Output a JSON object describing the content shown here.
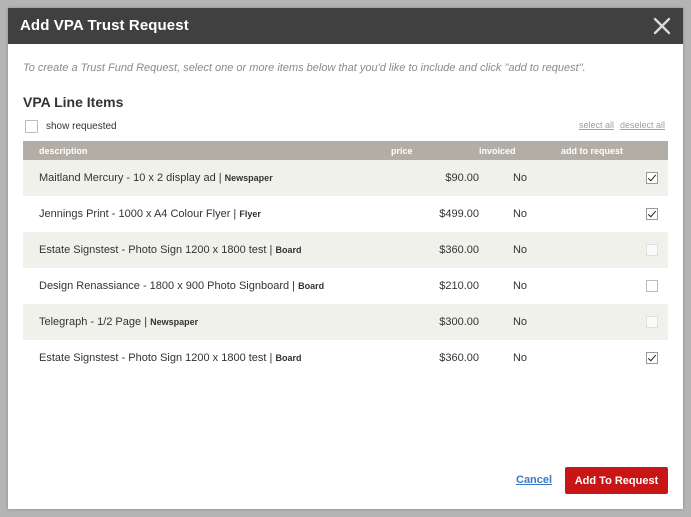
{
  "modal": {
    "title": "Add VPA Trust Request",
    "instructions": "To create a Trust Fund Request, select one or more items below that you'd like to include and click \"add to request\".",
    "section_heading": "VPA Line Items"
  },
  "filters": {
    "show_requested_label": "show requested",
    "show_requested_checked": false,
    "select_all_label": "select all",
    "deselect_all_label": "deselect all"
  },
  "table": {
    "headers": {
      "description": "description",
      "price": "price",
      "invoiced": "invoiced",
      "add_to_request": "add to request"
    },
    "rows": [
      {
        "description": "Maitland Mercury - 10 x 2 display ad",
        "type": "Newspaper",
        "price": "$90.00",
        "invoiced": "No",
        "checked": true,
        "disabled": false
      },
      {
        "description": "Jennings Print - 1000 x A4 Colour Flyer",
        "type": "Flyer",
        "price": "$499.00",
        "invoiced": "No",
        "checked": true,
        "disabled": false
      },
      {
        "description": "Estate Signstest - Photo Sign 1200 x 1800 test",
        "type": "Board",
        "price": "$360.00",
        "invoiced": "No",
        "checked": false,
        "disabled": true
      },
      {
        "description": "Design Renassiance - 1800 x 900 Photo Signboard",
        "type": "Board",
        "price": "$210.00",
        "invoiced": "No",
        "checked": false,
        "disabled": false
      },
      {
        "description": "Telegraph - 1/2 Page",
        "type": "Newspaper",
        "price": "$300.00",
        "invoiced": "No",
        "checked": false,
        "disabled": true
      },
      {
        "description": "Estate Signstest - Photo Sign 1200 x 1800 test",
        "type": "Board",
        "price": "$360.00",
        "invoiced": "No",
        "checked": true,
        "disabled": false
      }
    ]
  },
  "footer": {
    "cancel_label": "Cancel",
    "submit_label": "Add To Request"
  },
  "colors": {
    "header_bg": "#404040",
    "table_header_bg": "#b3aea5",
    "row_stripe": "#f1f1ec",
    "primary_button": "#c81515",
    "link": "#3b78c4"
  },
  "icons": {
    "close": "close-icon",
    "checkbox": "checkbox-icon"
  }
}
